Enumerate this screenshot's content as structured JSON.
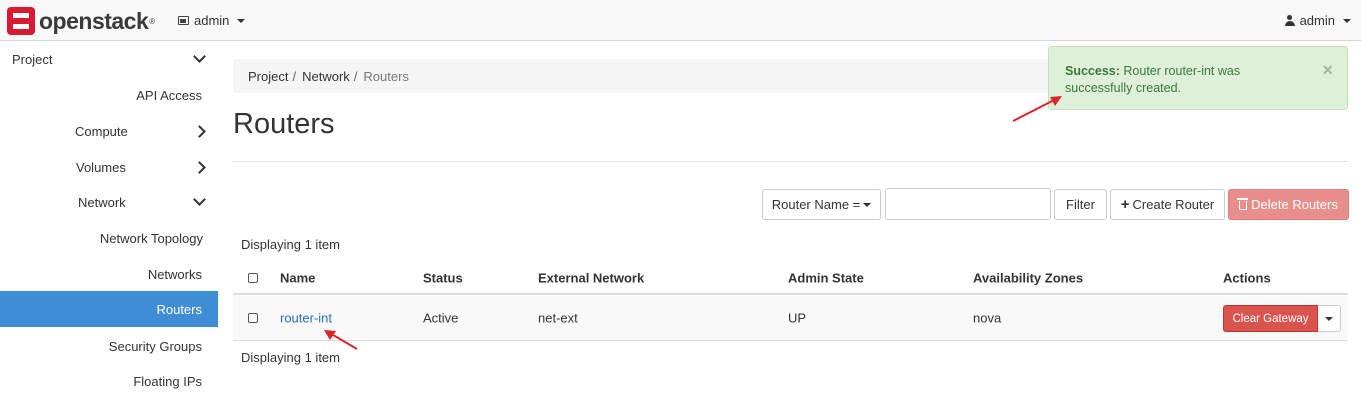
{
  "header": {
    "brand": "openstack",
    "brand_mark": "®",
    "project_switcher_label": "admin",
    "user_menu_label": "admin"
  },
  "sidebar": {
    "items": [
      {
        "label": "Project",
        "chevron": "down"
      },
      {
        "label": "API Access"
      },
      {
        "label": "Compute",
        "chevron": "right"
      },
      {
        "label": "Volumes",
        "chevron": "right"
      },
      {
        "label": "Network",
        "chevron": "down"
      },
      {
        "label": "Network Topology"
      },
      {
        "label": "Networks"
      },
      {
        "label": "Routers",
        "active": true
      },
      {
        "label": "Security Groups"
      },
      {
        "label": "Floating IPs"
      }
    ]
  },
  "breadcrumb": [
    "Project",
    "Network",
    "Routers"
  ],
  "page_title": "Routers",
  "toolbar": {
    "filter_field_label": "Router Name =",
    "filter_input_value": "",
    "filter_button": "Filter",
    "create_button": "Create Router",
    "delete_button": "Delete Routers"
  },
  "table": {
    "count_top": "Displaying 1 item",
    "count_bottom": "Displaying 1 item",
    "columns": [
      "Name",
      "Status",
      "External Network",
      "Admin State",
      "Availability Zones",
      "Actions"
    ],
    "rows": [
      {
        "name": "router-int",
        "status": "Active",
        "external_network": "net-ext",
        "admin_state": "UP",
        "availability_zones": "nova",
        "action": "Clear Gateway"
      }
    ]
  },
  "alert": {
    "title": "Success:",
    "message": "Router router-int was successfully created.",
    "close": "×"
  },
  "colors": {
    "accent": "#3f8ed5",
    "danger": "#d9534f",
    "success_bg": "#dff0d8",
    "success_text": "#3c763d",
    "link": "#2a6ebb",
    "annotation_arrow": "#d9252a"
  }
}
